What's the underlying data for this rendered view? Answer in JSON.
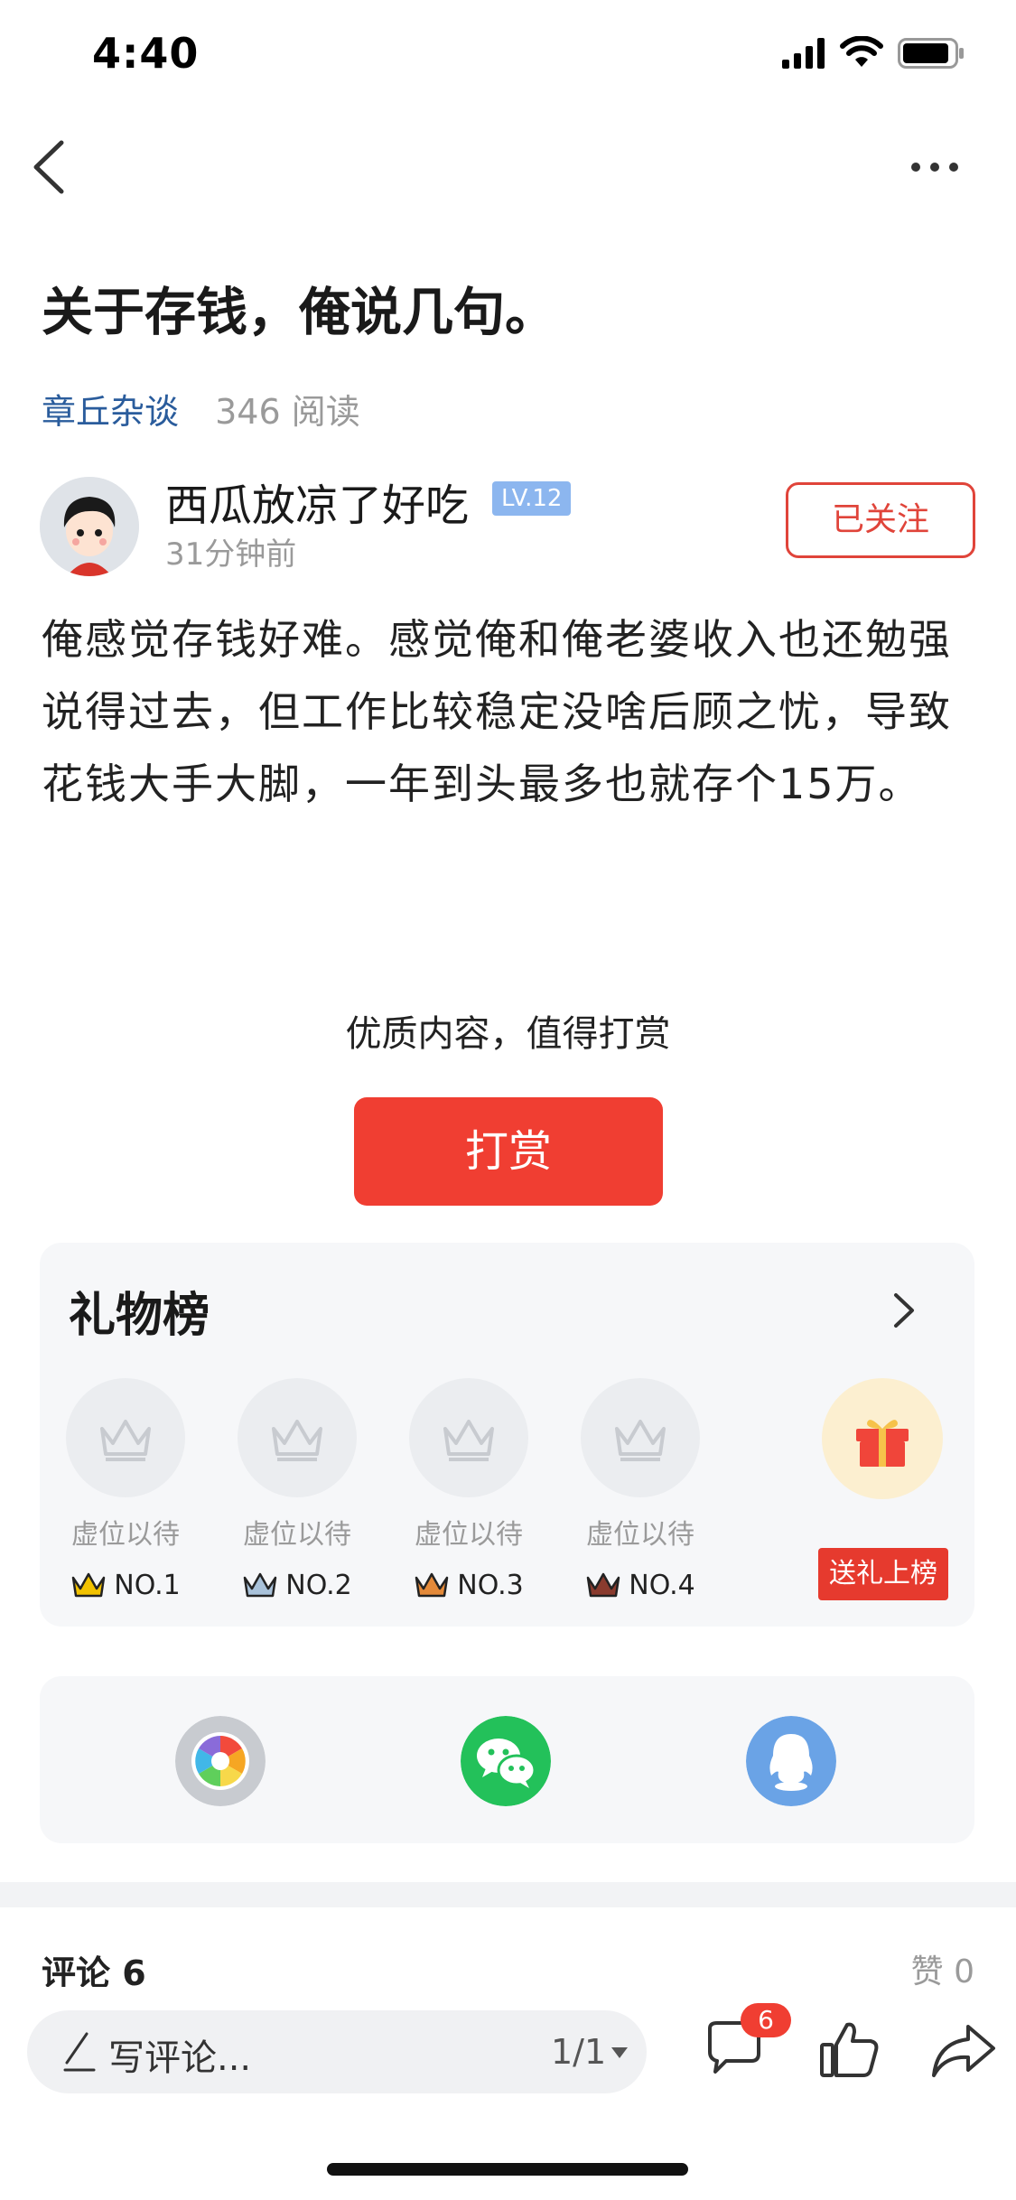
{
  "status_bar": {
    "time": "4:40"
  },
  "article": {
    "title": "关于存钱，俺说几句。",
    "channel": "章丘杂谈",
    "reads": "346 阅读",
    "author": {
      "name": "西瓜放凉了好吃",
      "level": "LV.12",
      "time": "31分钟前",
      "follow_label": "已关注"
    },
    "body": "俺感觉存钱好难。感觉俺和俺老婆收入也还勉强说得过去，但工作比较稳定没啥后顾之忧，导致花钱大手大脚，一年到头最多也就存个15万。"
  },
  "reward": {
    "prompt": "优质内容，值得打赏",
    "button_label": "打赏"
  },
  "gift_board": {
    "title": "礼物榜",
    "slots": [
      {
        "label": "虚位以待",
        "rank": "NO.1",
        "crown_color": "#f2c200"
      },
      {
        "label": "虚位以待",
        "rank": "NO.2",
        "crown_color": "#a9c2da"
      },
      {
        "label": "虚位以待",
        "rank": "NO.3",
        "crown_color": "#e48a3a"
      },
      {
        "label": "虚位以待",
        "rank": "NO.4",
        "crown_color": "#8a3b2e"
      }
    ],
    "send_label": "送礼上榜"
  },
  "share": {
    "items": [
      {
        "icon": "moments-icon",
        "color": "#c8cbd0"
      },
      {
        "icon": "wechat-icon",
        "color": "#23c15a"
      },
      {
        "icon": "qq-icon",
        "color": "#6aa3e6"
      }
    ]
  },
  "comments": {
    "header": "评论 6",
    "likes": "赞 0"
  },
  "bottom_bar": {
    "placeholder": "写评论...",
    "page_indicator": "1/1",
    "comment_count_badge": "6"
  },
  "colors": {
    "accent": "#f03e32",
    "link": "#2a5c9c",
    "level_badge": "#8cb6ef"
  }
}
